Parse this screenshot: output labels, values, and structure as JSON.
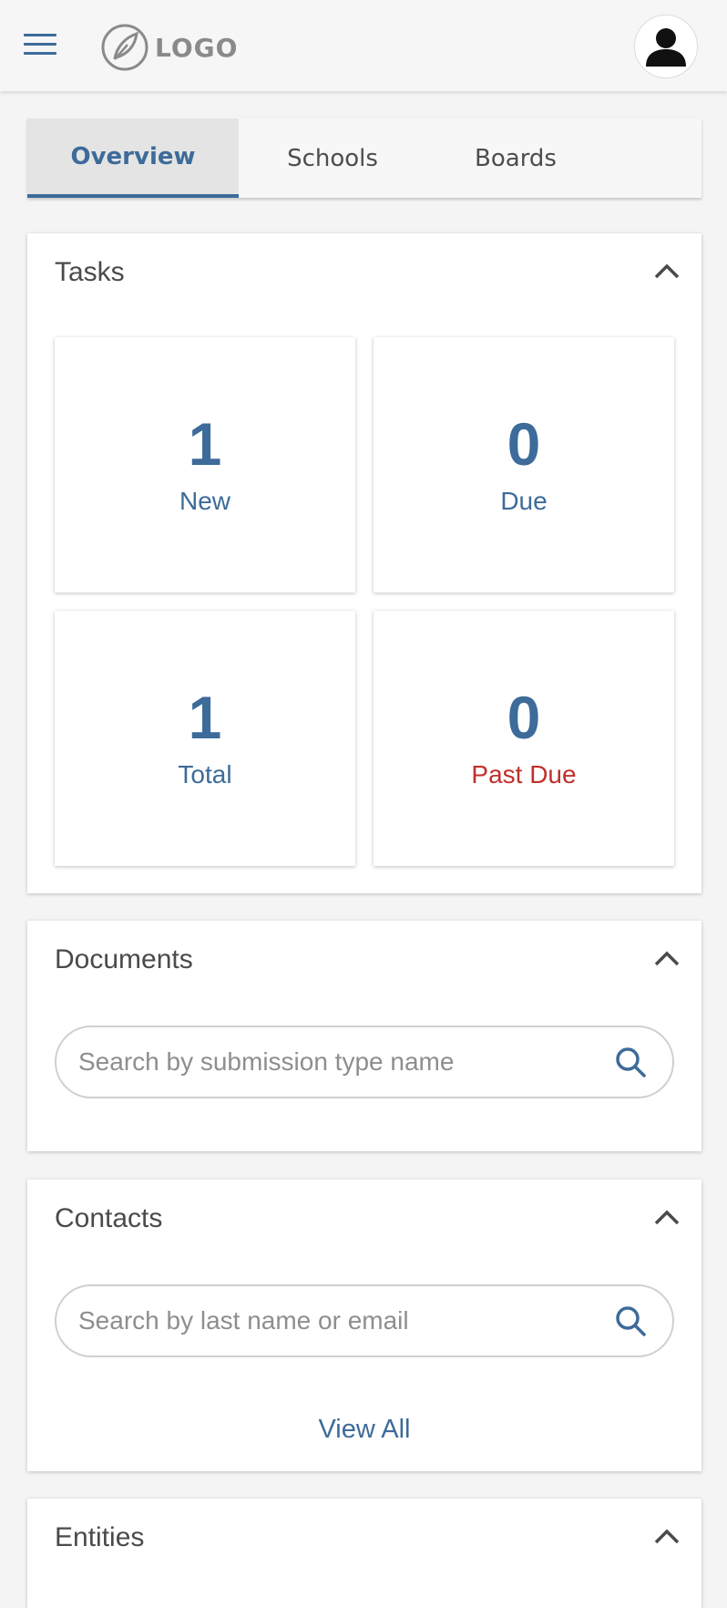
{
  "header": {
    "logo_text": "LOGO",
    "menu_icon": "hamburger-menu-icon",
    "avatar_icon": "user-avatar-icon"
  },
  "tabs": [
    {
      "label": "Overview",
      "active": true
    },
    {
      "label": "Schools",
      "active": false
    },
    {
      "label": "Boards",
      "active": false
    }
  ],
  "tasks": {
    "title": "Tasks",
    "tiles": [
      {
        "value": "1",
        "label": "New"
      },
      {
        "value": "0",
        "label": "Due"
      },
      {
        "value": "1",
        "label": "Total"
      },
      {
        "value": "0",
        "label": "Past Due"
      }
    ]
  },
  "documents": {
    "title": "Documents",
    "search_placeholder": "Search by submission type name"
  },
  "contacts": {
    "title": "Contacts",
    "search_placeholder": "Search by last name or email",
    "view_all": "View All"
  },
  "entities": {
    "title": "Entities"
  },
  "colors": {
    "accent": "#3d6b9a",
    "danger": "#c0302b",
    "header_bg": "#f6f6f6",
    "page_bg": "#f4f4f4"
  }
}
